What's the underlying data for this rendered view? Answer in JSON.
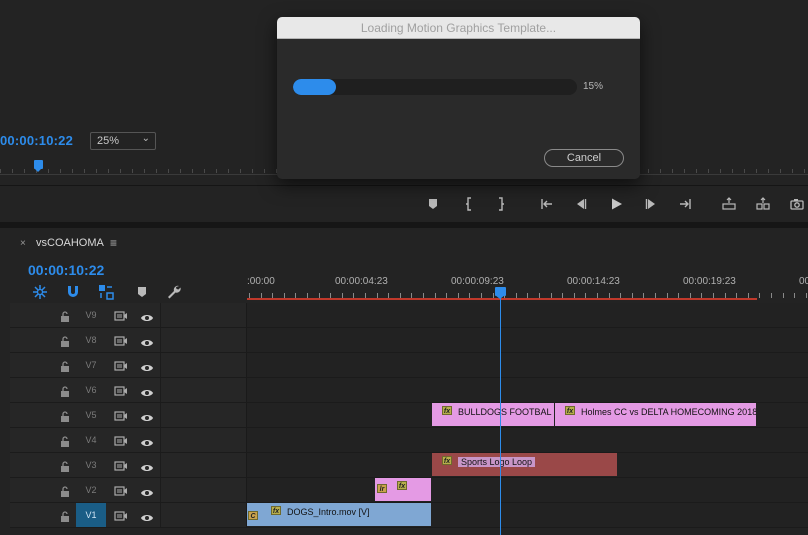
{
  "program_monitor": {
    "timecode": "00:00:10:22",
    "zoom": "25%"
  },
  "dialog": {
    "title": "Loading Motion Graphics Template...",
    "progress": 0.15,
    "progress_label": "15%",
    "cancel_label": "Cancel"
  },
  "transport": [
    "marker-icon",
    "mark-in-icon",
    "mark-out-icon",
    "go-to-in-icon",
    "step-back-icon",
    "play-icon",
    "step-forward-icon",
    "go-to-out-icon",
    "lift-icon",
    "extract-icon",
    "export-frame-icon"
  ],
  "sequence": {
    "close_glyph": "×",
    "name": "vsCOAHOMA",
    "menu_glyph": "≡",
    "timecode": "00:00:10:22",
    "ruler_labels": [
      ":00:00",
      "00:00:04:23",
      "00:00:09:23",
      "00:00:14:23",
      "00:00:19:23",
      "00:0"
    ],
    "tracks": [
      {
        "name": "V9",
        "active": false
      },
      {
        "name": "V8",
        "active": false
      },
      {
        "name": "V7",
        "active": false
      },
      {
        "name": "V6",
        "active": false
      },
      {
        "name": "V5",
        "active": false
      },
      {
        "name": "V4",
        "active": false
      },
      {
        "name": "V3",
        "active": false
      },
      {
        "name": "V2",
        "active": false
      },
      {
        "name": "V1",
        "active": true
      }
    ],
    "clips": {
      "v5_a": {
        "label": "BULLDOGS FOOTBAL",
        "fx": "fx"
      },
      "v5_b": {
        "label": "Holmes CC vs DELTA HOMECOMING 2018",
        "fx": "fx"
      },
      "v3_a": {
        "label": "Sports Logo Loop",
        "fx": "fx"
      },
      "v2_a": {
        "label": "",
        "fx": "fx",
        "badge": "lr"
      },
      "v1_a": {
        "label": "DOGS_Intro.mov [V]",
        "fx": "fx",
        "badge": "C"
      }
    }
  },
  "colors": {
    "accent": "#2d8ceb",
    "clip_pink": "#e49ae4",
    "clip_maroon": "#9a4848",
    "clip_blue": "#7fa7d3",
    "work_area": "#c0392b"
  }
}
